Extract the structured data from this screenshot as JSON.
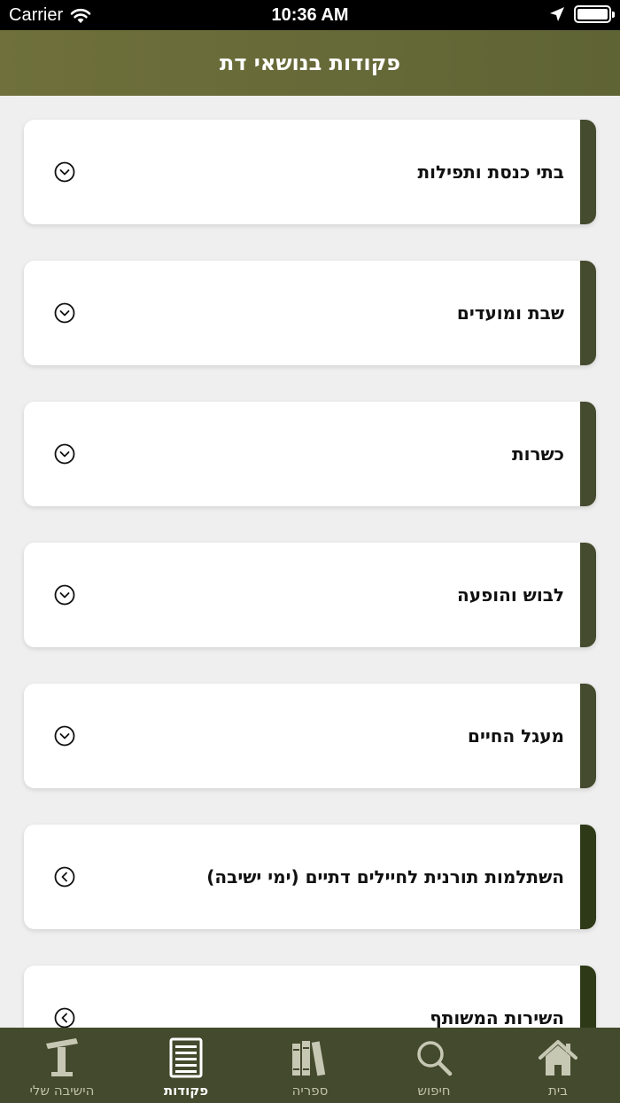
{
  "status": {
    "carrier": "Carrier",
    "time": "10:36 AM"
  },
  "header": {
    "title": "פקודות בנושאי דת"
  },
  "items": [
    {
      "label": "בתי כנסת ותפילות",
      "icon": "chevron-down-circle-icon"
    },
    {
      "label": "שבת ומועדים",
      "icon": "chevron-down-circle-icon"
    },
    {
      "label": "כשרות",
      "icon": "chevron-down-circle-icon"
    },
    {
      "label": "לבוש והופעה",
      "icon": "chevron-down-circle-icon"
    },
    {
      "label": "מעגל החיים",
      "icon": "chevron-down-circle-icon"
    },
    {
      "label": "השתלמות תורנית לחיילים דתיים (ימי ישיבה)",
      "icon": "chevron-left-circle-icon"
    },
    {
      "label": "השירות המשותף",
      "icon": "chevron-left-circle-icon"
    }
  ],
  "tabs": [
    {
      "label": "בית",
      "icon": "home-icon"
    },
    {
      "label": "חיפוש",
      "icon": "search-icon"
    },
    {
      "label": "ספריה",
      "icon": "books-icon"
    },
    {
      "label": "פקודות",
      "icon": "list-icon",
      "active": true
    },
    {
      "label": "הישיבה שלי",
      "icon": "torah-stand-icon"
    }
  ],
  "colors": {
    "header": "#6f703b",
    "tabbar": "#444a2d",
    "accent": "#454b2e",
    "accent_dark": "#2e3a17"
  }
}
